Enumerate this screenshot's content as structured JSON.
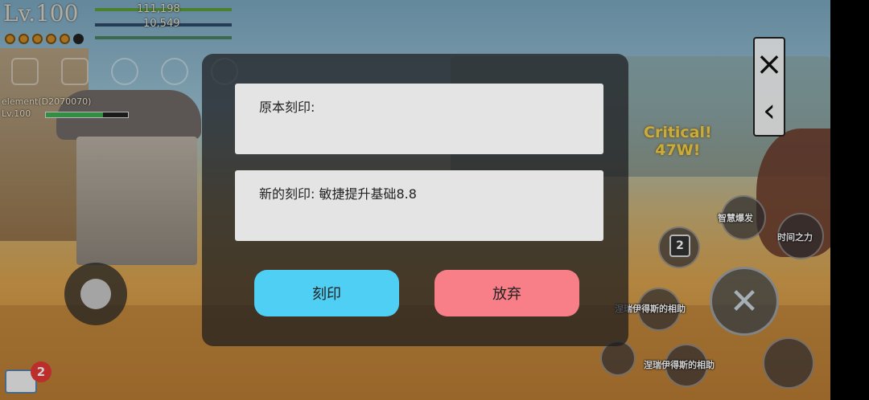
{
  "hud": {
    "level": "Lv.100",
    "hp": "111,198",
    "mp": "10,549",
    "target_name": "element(D2070070)",
    "target_level": "Lv.100",
    "chat_badge": "2"
  },
  "combat": {
    "critical_label": "Critical!",
    "critical_value": "47W!"
  },
  "skills": {
    "wisdom_burst": "智慧爆发",
    "time_power": "时间之力",
    "charges": "2",
    "blessing_1": "涅瑞伊得斯的相助",
    "blessing_2": "涅瑞伊得斯的相助"
  },
  "side_panel": {
    "close_glyph": "×",
    "back_glyph": "‹"
  },
  "modal": {
    "original_label": "原本刻印:",
    "new_label": "新的刻印: 敏捷提升基础8.8",
    "engrave_button": "刻印",
    "abandon_button": "放弃"
  },
  "colors": {
    "engrave_button": "#4fcff3",
    "abandon_button": "#f87f88",
    "panel_bg": "#1c1c1e"
  }
}
